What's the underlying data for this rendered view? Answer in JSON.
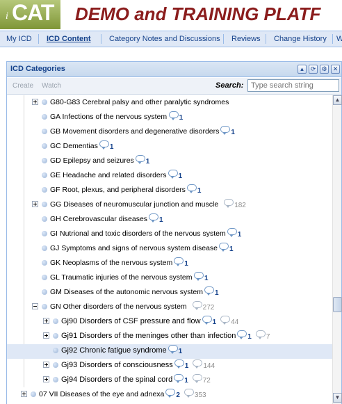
{
  "header": {
    "logo_prefix": "i",
    "logo_text": "CAT",
    "title": "DEMO and TRAINING PLATF"
  },
  "tabs": [
    {
      "label": "My ICD",
      "active": false
    },
    {
      "label": "ICD Content",
      "active": true
    },
    {
      "label": "Category Notes and Discussions",
      "active": false
    },
    {
      "label": "Reviews",
      "active": false
    },
    {
      "label": "Change History",
      "active": false
    },
    {
      "label": "W",
      "active": false
    }
  ],
  "panel": {
    "title": "ICD Categories",
    "tools": [
      "collapse-icon",
      "refresh-icon",
      "gear-icon",
      "close-icon"
    ]
  },
  "toolbar": {
    "create_label": "Create",
    "watch_label": "Watch",
    "search_label": "Search:",
    "search_placeholder": "Type search string",
    "search_value": ""
  },
  "tree": {
    "rows": [
      {
        "label": "G80-G83 Cerebral palsy and other paralytic syndromes",
        "expander": "plus",
        "level": 1,
        "notes": null,
        "grey_notes": null
      },
      {
        "label": "GA Infections of the nervous system",
        "expander": null,
        "level": 1,
        "notes": "1",
        "grey_notes": null
      },
      {
        "label": "GB Movement disorders and degenerative disorders",
        "expander": null,
        "level": 1,
        "notes": "1",
        "grey_notes": null
      },
      {
        "label": "GC Dementias",
        "expander": null,
        "level": 1,
        "notes": "1",
        "grey_notes": null
      },
      {
        "label": "GD Epilepsy and seizures",
        "expander": null,
        "level": 1,
        "notes": "1",
        "grey_notes": null
      },
      {
        "label": "GE Headache and related disorders",
        "expander": null,
        "level": 1,
        "notes": "1",
        "grey_notes": null
      },
      {
        "label": "GF Root, plexus, and peripheral disorders",
        "expander": null,
        "level": 1,
        "notes": "1",
        "grey_notes": null
      },
      {
        "label": "GG Diseases of neuromuscular junction and muscle",
        "expander": "plus",
        "level": 1,
        "notes": null,
        "grey_notes": "182"
      },
      {
        "label": "GH Cerebrovascular diseases",
        "expander": null,
        "level": 1,
        "notes": "1",
        "grey_notes": null
      },
      {
        "label": "GI Nutrional and toxic disorders of the nervous system",
        "expander": null,
        "level": 1,
        "notes": "1",
        "grey_notes": null
      },
      {
        "label": "GJ Symptoms and signs of nervous system disease",
        "expander": null,
        "level": 1,
        "notes": "1",
        "grey_notes": null
      },
      {
        "label": "GK Neoplasms of the nervous system",
        "expander": null,
        "level": 1,
        "notes": "1",
        "grey_notes": null
      },
      {
        "label": "GL Traumatic injuries of the nervous system",
        "expander": null,
        "level": 1,
        "notes": "1",
        "grey_notes": null
      },
      {
        "label": "GM Diseases of the autonomic nervous system",
        "expander": null,
        "level": 1,
        "notes": "1",
        "grey_notes": null
      },
      {
        "label": "GN Other disorders of the nervous system",
        "expander": "minus",
        "level": 1,
        "notes": null,
        "grey_notes": "272"
      },
      {
        "label": "Gj90 Disorders of CSF pressure and flow",
        "expander": "plus",
        "level": 2,
        "notes": "1",
        "grey_notes": "44"
      },
      {
        "label": "Gj91 Disorders of the meninges other than infection",
        "expander": "plus",
        "level": 2,
        "notes": "1",
        "grey_notes": "7"
      },
      {
        "label": "Gj92 Chronic fatigue syndrome",
        "expander": null,
        "level": 2,
        "notes": "1",
        "grey_notes": null,
        "selected": true
      },
      {
        "label": "Gj93 Disorders of consciousness",
        "expander": "plus",
        "level": 2,
        "notes": "1",
        "grey_notes": "144"
      },
      {
        "label": "Gj94 Disorders of the spinal cord",
        "expander": "plus",
        "level": 2,
        "notes": "1",
        "grey_notes": "72"
      },
      {
        "label": "07 VII Diseases of the eye and adnexa",
        "expander": "plus",
        "level": 0,
        "notes": "2",
        "grey_notes": "353"
      }
    ]
  }
}
